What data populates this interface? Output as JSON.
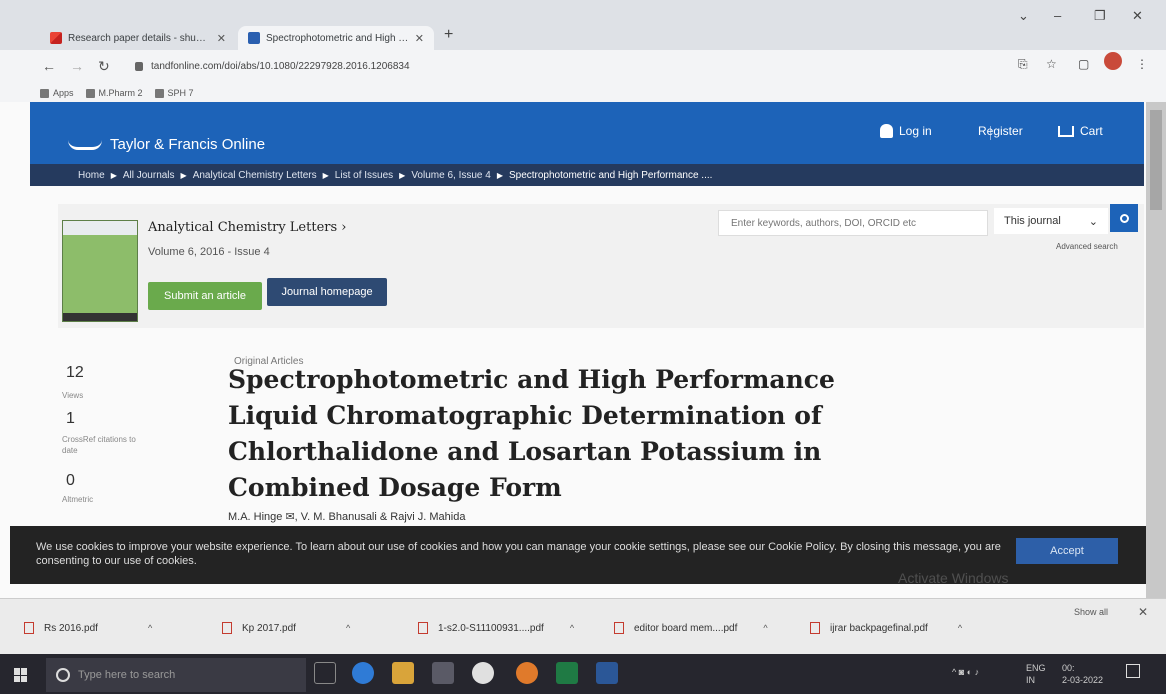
{
  "browser": {
    "tabs": [
      {
        "label": "Research paper details - shuch..."
      },
      {
        "label": "Spectrophotometric and High P..."
      }
    ],
    "url": "tandfonline.com/doi/abs/10.1080/22297928.2016.1206834",
    "bookmarks": [
      {
        "label": "Apps"
      },
      {
        "label": "M.Pharm 2"
      },
      {
        "label": "SPH 7"
      }
    ]
  },
  "site": {
    "logo_text": "Taylor & Francis Online",
    "login_label": "Log in",
    "register_label": "Register",
    "cart_label": "Cart",
    "breadcrumbs": [
      "Home",
      "All Journals",
      "Analytical Chemistry Letters",
      "List of Issues",
      "Volume 6, Issue 4",
      "Spectrophotometric and High Performance ...."
    ]
  },
  "journal": {
    "name": "Analytical Chemistry Letters ›",
    "volume": "Volume 6, 2016 - Issue 4",
    "submit_label": "Submit an article",
    "homepage_label": "Journal homepage"
  },
  "search": {
    "placeholder": "Enter keywords, authors, DOI, ORCID etc",
    "scope": "This journal",
    "advanced_label": "Advanced search"
  },
  "metrics": [
    {
      "value": "12",
      "label": "Views"
    },
    {
      "value": "1",
      "label": "CrossRef citations to date"
    },
    {
      "value": "0",
      "label": "Altmetric"
    }
  ],
  "article": {
    "type": "Original Articles",
    "title": "Spectrophotometric and High Performance Liquid Chromatographic Determination of Chlorthalidone and Losartan Potassium in Combined Dosage Form",
    "authors": "M.A. Hinge ✉, V. M. Bhanusali & Rajvi J. Mahida"
  },
  "cookie": {
    "message": "We use cookies to improve your website experience. To learn about our use of cookies and how you can manage your cookie settings, please see our Cookie Policy. By closing this message, you are consenting to our use of cookies.",
    "accept_label": "Accept",
    "watermark": "Activate Windows"
  },
  "downloads": {
    "items": [
      {
        "name": "Rs 2016.pdf"
      },
      {
        "name": "Kp 2017.pdf"
      },
      {
        "name": "1-s2.0-S11100931....pdf"
      },
      {
        "name": "editor board mem....pdf"
      },
      {
        "name": "ijrar backpagefinal.pdf"
      }
    ],
    "show_all_label": "Show all"
  },
  "taskbar": {
    "search_placeholder": "Type here to search",
    "lang": "ENG",
    "region": "IN",
    "time": "00:",
    "date": "2-03-2022"
  },
  "colors": {
    "tf_blue": "#1d63b8",
    "breadcrumb_navy": "#253a5e",
    "submit_green": "#6aaa4c",
    "homepage_navy": "#2e4a73"
  }
}
